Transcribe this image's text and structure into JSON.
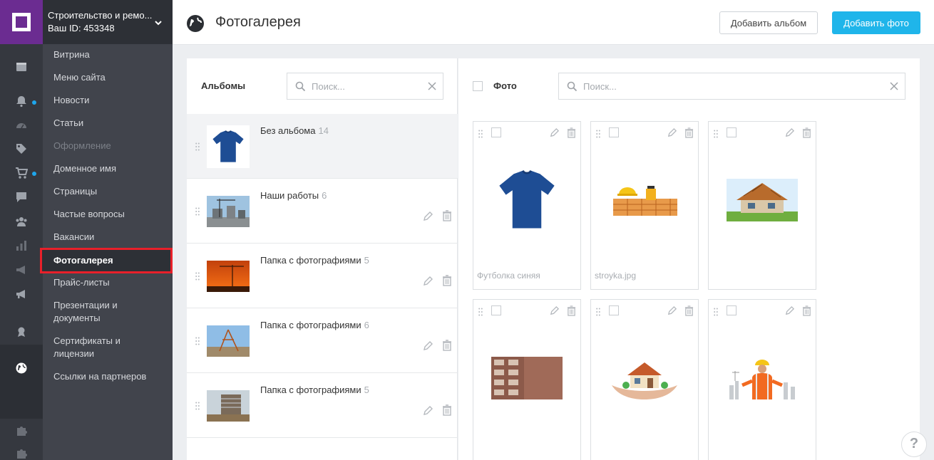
{
  "site": {
    "name": "Строительство и ремо...",
    "id_label": "Ваш ID: 453348"
  },
  "menu": [
    {
      "label": "Витрина",
      "state": "normal"
    },
    {
      "label": "Меню сайта",
      "state": "normal"
    },
    {
      "label": "Новости",
      "state": "normal"
    },
    {
      "label": "Статьи",
      "state": "normal"
    },
    {
      "label": "Оформление",
      "state": "disabled"
    },
    {
      "label": "Доменное имя",
      "state": "normal"
    },
    {
      "label": "Страницы",
      "state": "normal"
    },
    {
      "label": "Частые вопросы",
      "state": "normal"
    },
    {
      "label": "Вакансии",
      "state": "normal"
    },
    {
      "label": "Фотогалерея",
      "state": "active"
    },
    {
      "label": "Прайс-листы",
      "state": "normal"
    },
    {
      "label": "Презентации и документы",
      "state": "normal"
    },
    {
      "label": "Сертификаты и лицензии",
      "state": "normal"
    },
    {
      "label": "Ссылки на партнеров",
      "state": "normal"
    }
  ],
  "header": {
    "title": "Фотогалерея",
    "add_album_label": "Добавить альбом",
    "add_photo_label": "Добавить фото"
  },
  "albums_panel": {
    "title": "Альбомы",
    "search_placeholder": "Поиск...",
    "items": [
      {
        "name": "Без альбома",
        "count": "14",
        "selected": true
      },
      {
        "name": "Наши работы",
        "count": "6",
        "selected": false
      },
      {
        "name": "Папка с фотографиями",
        "count": "5",
        "selected": false
      },
      {
        "name": "Папка с фотографиями",
        "count": "6",
        "selected": false
      },
      {
        "name": "Папка с фотографиями",
        "count": "5",
        "selected": false
      }
    ]
  },
  "photos_panel": {
    "title": "Фото",
    "search_placeholder": "Поиск...",
    "items": [
      {
        "caption": "Футболка синяя"
      },
      {
        "caption": "stroyka.jpg"
      },
      {
        "caption": ""
      },
      {
        "caption": ""
      },
      {
        "caption": ""
      },
      {
        "caption": ""
      }
    ]
  },
  "help": {
    "label": "?"
  },
  "colors": {
    "brand": "#6b2c91",
    "accent": "#1fb5ea",
    "highlight": "#e8202a",
    "notification": "#1ea6ec"
  }
}
